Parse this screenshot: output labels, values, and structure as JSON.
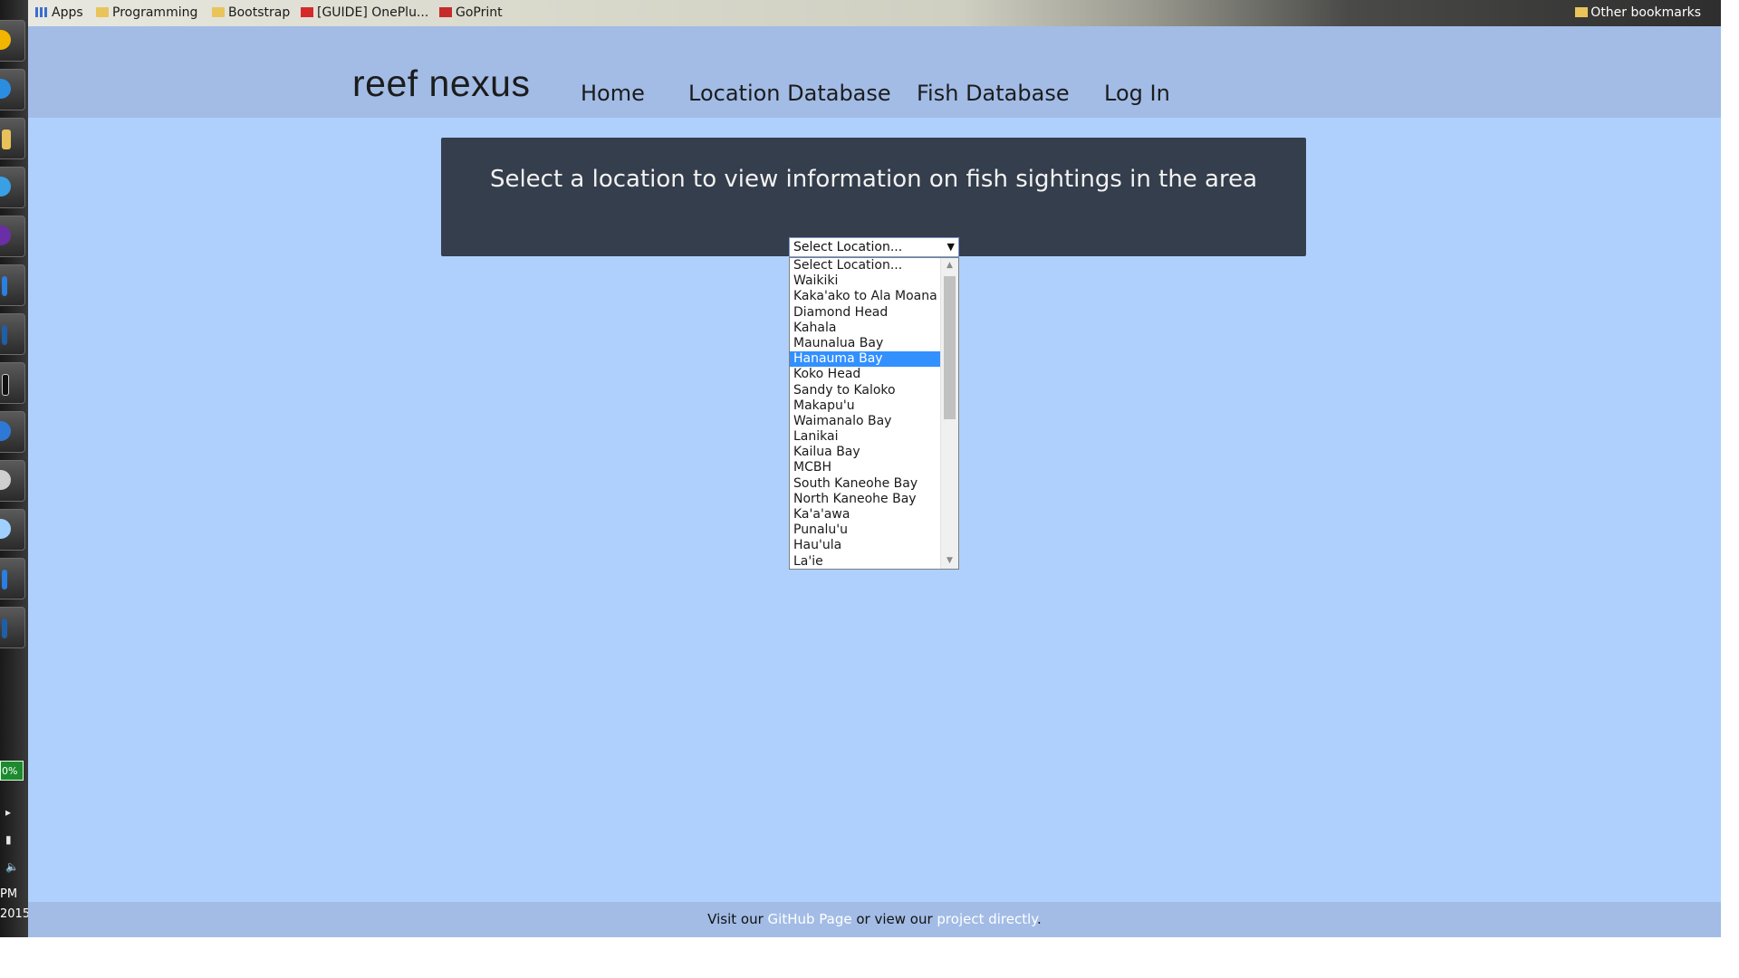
{
  "browser": {
    "bookmarks": [
      {
        "label": "Apps",
        "icon": "apps-grid-icon"
      },
      {
        "label": "Programming",
        "icon": "folder-icon"
      },
      {
        "label": "Bootstrap",
        "icon": "folder-icon"
      },
      {
        "label": "[GUIDE] OnePlu...",
        "icon": "oneplus-icon"
      },
      {
        "label": "GoPrint",
        "icon": "goprint-icon"
      }
    ],
    "other_bookmarks": "Other bookmarks"
  },
  "taskbar": {
    "battery": "0%",
    "time": "PM",
    "date": "2015"
  },
  "site": {
    "brand": "reef nexus",
    "nav": [
      "Home",
      "Location Database",
      "Fish Database",
      "Log In"
    ]
  },
  "panel": {
    "title": "Select a location to view information on fish sightings in the area",
    "select_value": "Select Location...",
    "options": [
      "Select Location...",
      "Waikiki",
      "Kaka'ako to Ala Moana",
      "Diamond Head",
      "Kahala",
      "Maunalua Bay",
      "Hanauma Bay",
      "Koko Head",
      "Sandy to Kaloko",
      "Makapu'u",
      "Waimanalo Bay",
      "Lanikai",
      "Kailua Bay",
      "MCBH",
      "South Kaneohe Bay",
      "North Kaneohe Bay",
      "Ka'a'awa",
      "Punalu'u",
      "Hau'ula",
      "La'ie"
    ],
    "highlighted": "Hanauma Bay"
  },
  "footer": {
    "prefix": "Visit our ",
    "github_link": "GitHub Page",
    "middle": " or view our ",
    "project_link": "project directly",
    "suffix": "."
  },
  "colors": {
    "page_bg": "#afd0fc",
    "navbar_bg": "#a2bce6",
    "panel_bg": "#353e4c",
    "selection": "#3390ff"
  }
}
